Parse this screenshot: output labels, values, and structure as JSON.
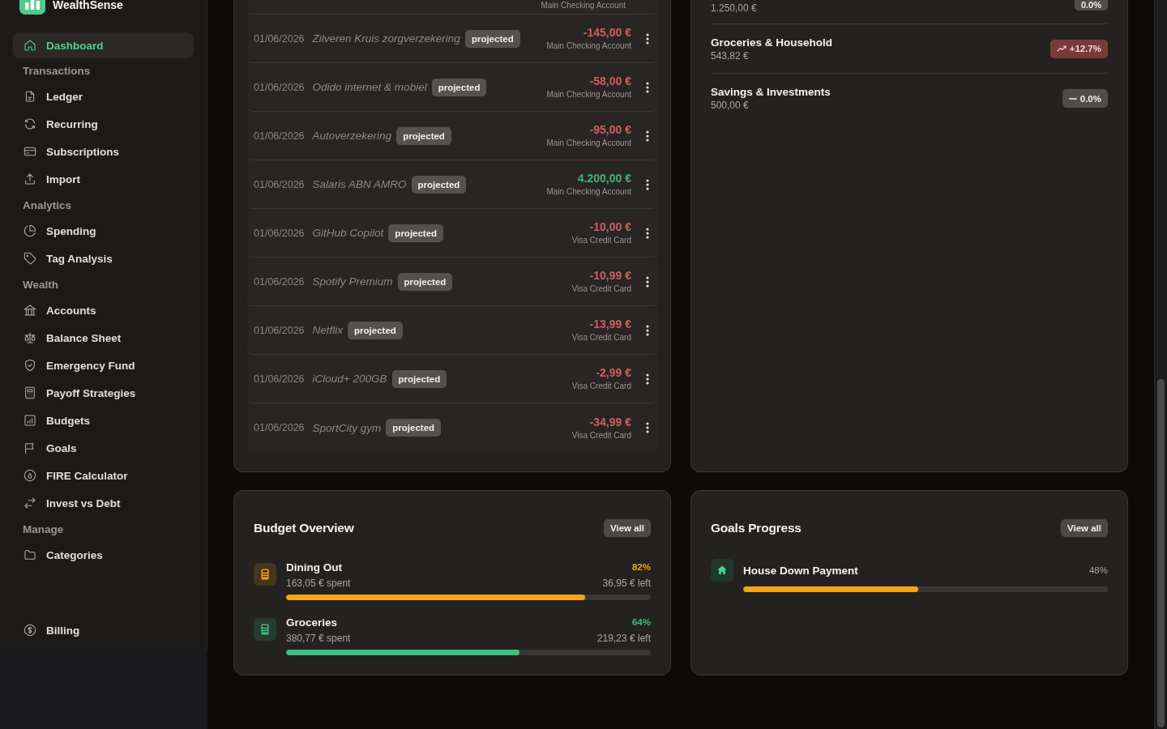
{
  "brand": {
    "name": "WealthSense"
  },
  "sidebar": {
    "sections": [
      {
        "items": [
          {
            "label": "Dashboard",
            "selected": true
          }
        ]
      },
      {
        "title": "Transactions",
        "items": [
          {
            "label": "Ledger",
            "selected": false
          },
          {
            "label": "Recurring",
            "selected": false
          },
          {
            "label": "Subscriptions",
            "selected": false
          },
          {
            "label": "Import",
            "selected": false
          }
        ]
      },
      {
        "title": "Analytics",
        "items": [
          {
            "label": "Spending",
            "selected": false
          },
          {
            "label": "Tag Analysis",
            "selected": false
          }
        ]
      },
      {
        "title": "Wealth",
        "items": [
          {
            "label": "Accounts",
            "selected": false
          },
          {
            "label": "Balance Sheet",
            "selected": false
          },
          {
            "label": "Emergency Fund",
            "selected": false
          },
          {
            "label": "Payoff Strategies",
            "selected": false
          },
          {
            "label": "Budgets",
            "selected": false
          },
          {
            "label": "Goals",
            "selected": false
          },
          {
            "label": "FIRE Calculator",
            "selected": false
          },
          {
            "label": "Invest vs Debt",
            "selected": false
          }
        ]
      },
      {
        "title": "Manage",
        "items": [
          {
            "label": "Categories",
            "selected": false
          }
        ]
      }
    ],
    "footer_items": [
      {
        "label": "Billing",
        "selected": false
      }
    ]
  },
  "transactions": [
    {
      "account": "Main Checking Account"
    },
    {
      "date": "01/06/2026",
      "description": "Zilveren Kruis zorgverzekering",
      "status": "projected",
      "amount": "-145,00 €",
      "kind": "expense",
      "account": "Main Checking Account"
    },
    {
      "date": "01/06/2026",
      "description": "Odido internet & mobiel",
      "status": "projected",
      "amount": "-58,00 €",
      "kind": "expense",
      "account": "Main Checking Account"
    },
    {
      "date": "01/06/2026",
      "description": "Autoverzekering",
      "status": "projected",
      "amount": "-95,00 €",
      "kind": "expense",
      "account": "Main Checking Account"
    },
    {
      "date": "01/06/2026",
      "description": "Salaris ABN AMRO",
      "status": "projected",
      "amount": "4.200,00 €",
      "kind": "income",
      "account": "Main Checking Account"
    },
    {
      "date": "01/06/2026",
      "description": "GitHub Copilot",
      "status": "projected",
      "amount": "-10,00 €",
      "kind": "expense",
      "account": "Visa Credit Card"
    },
    {
      "date": "01/06/2026",
      "description": "Spotify Premium",
      "status": "projected",
      "amount": "-10,99 €",
      "kind": "expense",
      "account": "Visa Credit Card"
    },
    {
      "date": "01/06/2026",
      "description": "Netflix",
      "status": "projected",
      "amount": "-13,99 €",
      "kind": "expense",
      "account": "Visa Credit Card"
    },
    {
      "date": "01/06/2026",
      "description": "iCloud+ 200GB",
      "status": "projected",
      "amount": "-2,99 €",
      "kind": "expense",
      "account": "Visa Credit Card"
    },
    {
      "date": "01/06/2026",
      "description": "SportCity gym",
      "status": "projected",
      "amount": "-34,99 €",
      "kind": "expense",
      "account": "Visa Credit Card"
    }
  ],
  "categories": [
    {
      "amount": "1.250,00 €",
      "change": "0.0%",
      "kind": "flat"
    },
    {
      "name": "Groceries & Household",
      "amount": "543,82 €",
      "change": "+12.7%",
      "kind": "up"
    },
    {
      "name": "Savings & Investments",
      "amount": "500,00 €",
      "change": "0.0%",
      "kind": "flat"
    }
  ],
  "budget": {
    "title": "Budget Overview",
    "action": "View all",
    "items": [
      {
        "name": "Dining Out",
        "percent": "82%",
        "spent": "163,05 € spent",
        "left": "36,95 € left",
        "level": 0.82,
        "color": "#f5a418"
      },
      {
        "name": "Groceries",
        "percent": "64%",
        "spent": "380,77 € spent",
        "left": "219,23 € left",
        "level": 0.64,
        "color": "#3fbf7f"
      }
    ]
  },
  "goals": {
    "title": "Goals Progress",
    "action": "View all",
    "items": [
      {
        "name": "House Down Payment",
        "percent": "48%",
        "level": 0.48
      }
    ]
  }
}
